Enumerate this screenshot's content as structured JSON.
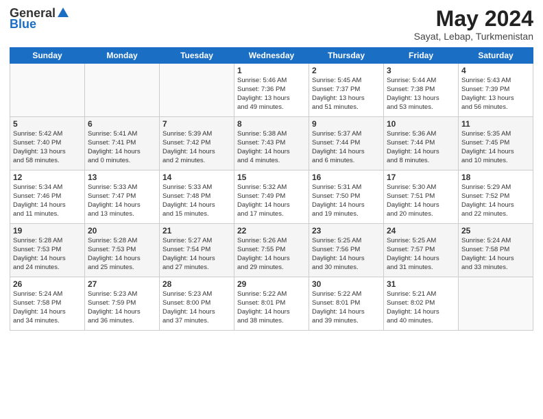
{
  "logo": {
    "general": "General",
    "blue": "Blue"
  },
  "header": {
    "month": "May 2024",
    "location": "Sayat, Lebap, Turkmenistan"
  },
  "days_of_week": [
    "Sunday",
    "Monday",
    "Tuesday",
    "Wednesday",
    "Thursday",
    "Friday",
    "Saturday"
  ],
  "weeks": [
    [
      {
        "day": "",
        "info": ""
      },
      {
        "day": "",
        "info": ""
      },
      {
        "day": "",
        "info": ""
      },
      {
        "day": "1",
        "info": "Sunrise: 5:46 AM\nSunset: 7:36 PM\nDaylight: 13 hours\nand 49 minutes."
      },
      {
        "day": "2",
        "info": "Sunrise: 5:45 AM\nSunset: 7:37 PM\nDaylight: 13 hours\nand 51 minutes."
      },
      {
        "day": "3",
        "info": "Sunrise: 5:44 AM\nSunset: 7:38 PM\nDaylight: 13 hours\nand 53 minutes."
      },
      {
        "day": "4",
        "info": "Sunrise: 5:43 AM\nSunset: 7:39 PM\nDaylight: 13 hours\nand 56 minutes."
      }
    ],
    [
      {
        "day": "5",
        "info": "Sunrise: 5:42 AM\nSunset: 7:40 PM\nDaylight: 13 hours\nand 58 minutes."
      },
      {
        "day": "6",
        "info": "Sunrise: 5:41 AM\nSunset: 7:41 PM\nDaylight: 14 hours\nand 0 minutes."
      },
      {
        "day": "7",
        "info": "Sunrise: 5:39 AM\nSunset: 7:42 PM\nDaylight: 14 hours\nand 2 minutes."
      },
      {
        "day": "8",
        "info": "Sunrise: 5:38 AM\nSunset: 7:43 PM\nDaylight: 14 hours\nand 4 minutes."
      },
      {
        "day": "9",
        "info": "Sunrise: 5:37 AM\nSunset: 7:44 PM\nDaylight: 14 hours\nand 6 minutes."
      },
      {
        "day": "10",
        "info": "Sunrise: 5:36 AM\nSunset: 7:44 PM\nDaylight: 14 hours\nand 8 minutes."
      },
      {
        "day": "11",
        "info": "Sunrise: 5:35 AM\nSunset: 7:45 PM\nDaylight: 14 hours\nand 10 minutes."
      }
    ],
    [
      {
        "day": "12",
        "info": "Sunrise: 5:34 AM\nSunset: 7:46 PM\nDaylight: 14 hours\nand 11 minutes."
      },
      {
        "day": "13",
        "info": "Sunrise: 5:33 AM\nSunset: 7:47 PM\nDaylight: 14 hours\nand 13 minutes."
      },
      {
        "day": "14",
        "info": "Sunrise: 5:33 AM\nSunset: 7:48 PM\nDaylight: 14 hours\nand 15 minutes."
      },
      {
        "day": "15",
        "info": "Sunrise: 5:32 AM\nSunset: 7:49 PM\nDaylight: 14 hours\nand 17 minutes."
      },
      {
        "day": "16",
        "info": "Sunrise: 5:31 AM\nSunset: 7:50 PM\nDaylight: 14 hours\nand 19 minutes."
      },
      {
        "day": "17",
        "info": "Sunrise: 5:30 AM\nSunset: 7:51 PM\nDaylight: 14 hours\nand 20 minutes."
      },
      {
        "day": "18",
        "info": "Sunrise: 5:29 AM\nSunset: 7:52 PM\nDaylight: 14 hours\nand 22 minutes."
      }
    ],
    [
      {
        "day": "19",
        "info": "Sunrise: 5:28 AM\nSunset: 7:53 PM\nDaylight: 14 hours\nand 24 minutes."
      },
      {
        "day": "20",
        "info": "Sunrise: 5:28 AM\nSunset: 7:53 PM\nDaylight: 14 hours\nand 25 minutes."
      },
      {
        "day": "21",
        "info": "Sunrise: 5:27 AM\nSunset: 7:54 PM\nDaylight: 14 hours\nand 27 minutes."
      },
      {
        "day": "22",
        "info": "Sunrise: 5:26 AM\nSunset: 7:55 PM\nDaylight: 14 hours\nand 29 minutes."
      },
      {
        "day": "23",
        "info": "Sunrise: 5:25 AM\nSunset: 7:56 PM\nDaylight: 14 hours\nand 30 minutes."
      },
      {
        "day": "24",
        "info": "Sunrise: 5:25 AM\nSunset: 7:57 PM\nDaylight: 14 hours\nand 31 minutes."
      },
      {
        "day": "25",
        "info": "Sunrise: 5:24 AM\nSunset: 7:58 PM\nDaylight: 14 hours\nand 33 minutes."
      }
    ],
    [
      {
        "day": "26",
        "info": "Sunrise: 5:24 AM\nSunset: 7:58 PM\nDaylight: 14 hours\nand 34 minutes."
      },
      {
        "day": "27",
        "info": "Sunrise: 5:23 AM\nSunset: 7:59 PM\nDaylight: 14 hours\nand 36 minutes."
      },
      {
        "day": "28",
        "info": "Sunrise: 5:23 AM\nSunset: 8:00 PM\nDaylight: 14 hours\nand 37 minutes."
      },
      {
        "day": "29",
        "info": "Sunrise: 5:22 AM\nSunset: 8:01 PM\nDaylight: 14 hours\nand 38 minutes."
      },
      {
        "day": "30",
        "info": "Sunrise: 5:22 AM\nSunset: 8:01 PM\nDaylight: 14 hours\nand 39 minutes."
      },
      {
        "day": "31",
        "info": "Sunrise: 5:21 AM\nSunset: 8:02 PM\nDaylight: 14 hours\nand 40 minutes."
      },
      {
        "day": "",
        "info": ""
      }
    ]
  ]
}
